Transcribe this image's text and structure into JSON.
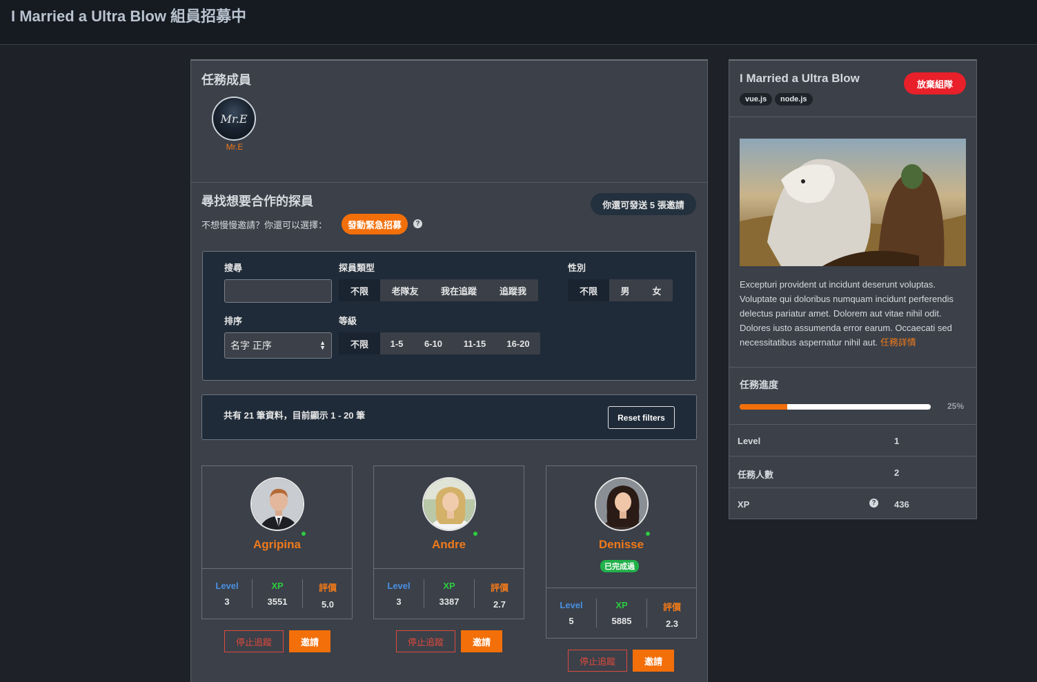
{
  "page": {
    "title": "I Married a Ultra Blow 組員招募中"
  },
  "members": {
    "title": "任務成員",
    "items": [
      {
        "name": "Mr.E",
        "avatar_text": "Mr.E"
      }
    ]
  },
  "find": {
    "title": "尋找想要合作的探員",
    "invites_left": "你還可發送 5 張邀請",
    "alt_text": "不想慢慢邀請？你還可以選擇：",
    "urgent_button": "發動緊急招募",
    "help_icon": "?"
  },
  "filters": {
    "search_label": "搜尋",
    "search_value": "",
    "agent_type_label": "探員類型",
    "agent_type_options": [
      "不限",
      "老隊友",
      "我在追蹤",
      "追蹤我"
    ],
    "gender_label": "性別",
    "gender_options": [
      "不限",
      "男",
      "女"
    ],
    "sort_label": "排序",
    "sort_value": "名字 正序",
    "level_label": "等級",
    "level_options": [
      "不限",
      "1-5",
      "6-10",
      "11-15",
      "16-20"
    ]
  },
  "results": {
    "summary": "共有 21 筆資料，目前顯示 1 - 20 筆",
    "reset_button": "Reset filters"
  },
  "stat_labels": {
    "level": "Level",
    "xp": "XP",
    "rating": "評價"
  },
  "colors": {
    "accent": "#f36f0a",
    "level": "#4a90e2",
    "xp": "#2ecc40",
    "rating": "#f07a1a",
    "danger": "#e8202a",
    "online": "#2ecc40"
  },
  "agents": [
    {
      "name": "Agripina",
      "level": "3",
      "xp": "3551",
      "rating": "5.0",
      "badge": "",
      "unfollow": "停止追蹤",
      "invite": "邀請",
      "online": true
    },
    {
      "name": "Andre",
      "level": "3",
      "xp": "3387",
      "rating": "2.7",
      "badge": "",
      "unfollow": "停止追蹤",
      "invite": "邀請",
      "online": true
    },
    {
      "name": "Denisse",
      "level": "5",
      "xp": "5885",
      "rating": "2.3",
      "badge": "已完成過",
      "unfollow": "停止追蹤",
      "invite": "邀請",
      "online": true
    }
  ],
  "mission": {
    "title": "I Married a Ultra Blow",
    "quit_button": "放棄組隊",
    "tags": [
      "vue.js",
      "node.js"
    ],
    "description": "Excepturi provident ut incidunt deserunt voluptas. Voluptate qui doloribus numquam incidunt perferendis delectus pariatur amet. Dolorem aut vitae nihil odit. Dolores iusto assumenda error earum. Occaecati sed necessitatibus aspernatur nihil aut.",
    "details_link": "任務詳情",
    "progress_label": "任務進度",
    "progress_value": 0.25,
    "progress_text": "25%",
    "info": [
      {
        "label": "Level",
        "value": "1"
      },
      {
        "label": "任務人數",
        "value": "2"
      },
      {
        "label": "XP",
        "value": "436"
      }
    ]
  }
}
